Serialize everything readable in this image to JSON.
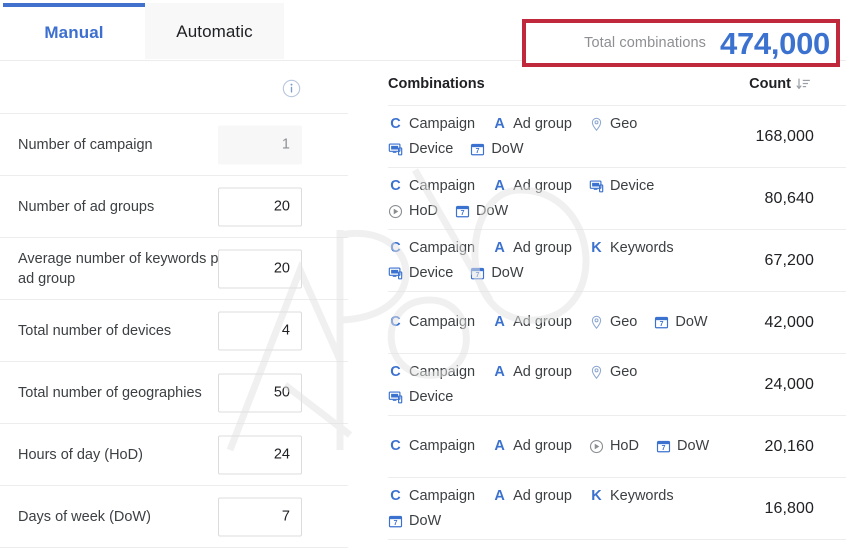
{
  "tabs": [
    {
      "label": "Manual",
      "active": true,
      "name": "tab-manual"
    },
    {
      "label": "Automatic",
      "active": false,
      "name": "tab-automatic"
    }
  ],
  "colors": {
    "accent_blue": "#3c72cf",
    "tab_active_border": "#4171cd",
    "callout_border": "#c0283b",
    "text_primary": "#202124",
    "text_secondary": "#8d8f92",
    "divider": "#ededed"
  },
  "summary": {
    "label": "Total combinations",
    "value": "474,000",
    "highlight_border_color": "#c0283b"
  },
  "form": {
    "info_icon": "info-circle-icon",
    "fields": [
      {
        "label": "Number of campaign",
        "value": "1",
        "disabled": true
      },
      {
        "label": "Number of ad groups",
        "value": "20",
        "disabled": false
      },
      {
        "label": "Average number of keywords per ad group",
        "value": "20",
        "disabled": false
      },
      {
        "label": "Total number of devices",
        "value": "4",
        "disabled": false
      },
      {
        "label": "Total number of geographies",
        "value": "50",
        "disabled": false
      },
      {
        "label": "Hours of day (HoD)",
        "value": "24",
        "disabled": false
      },
      {
        "label": "Days of week (DoW)",
        "value": "7",
        "disabled": false
      }
    ]
  },
  "table": {
    "columns": [
      {
        "header": "Combinations",
        "name": "column-combinations"
      },
      {
        "header": "Count",
        "name": "column-count",
        "sort_icon": "sort-descending-icon",
        "sorted": "descending"
      }
    ],
    "rows": [
      {
        "tags": [
          {
            "label": "Campaign",
            "icon": "letter-c-icon"
          },
          {
            "label": "Ad group",
            "icon": "letter-a-icon"
          },
          {
            "label": "Geo",
            "icon": "map-pin-icon"
          },
          {
            "label": "Device",
            "icon": "device-monitor-icon"
          },
          {
            "label": "DoW",
            "icon": "calendar-icon"
          }
        ],
        "count": "168,000"
      },
      {
        "tags": [
          {
            "label": "Campaign",
            "icon": "letter-c-icon"
          },
          {
            "label": "Ad group",
            "icon": "letter-a-icon"
          },
          {
            "label": "Device",
            "icon": "device-monitor-icon"
          },
          {
            "label": "HoD",
            "icon": "clock-icon"
          },
          {
            "label": "DoW",
            "icon": "calendar-icon"
          }
        ],
        "count": "80,640"
      },
      {
        "tags": [
          {
            "label": "Campaign",
            "icon": "letter-c-icon"
          },
          {
            "label": "Ad group",
            "icon": "letter-a-icon"
          },
          {
            "label": "Keywords",
            "icon": "letter-k-icon"
          },
          {
            "label": "Device",
            "icon": "device-monitor-icon"
          },
          {
            "label": "DoW",
            "icon": "calendar-icon"
          }
        ],
        "count": "67,200"
      },
      {
        "tags": [
          {
            "label": "Campaign",
            "icon": "letter-c-icon"
          },
          {
            "label": "Ad group",
            "icon": "letter-a-icon"
          },
          {
            "label": "Geo",
            "icon": "map-pin-icon"
          },
          {
            "label": "DoW",
            "icon": "calendar-icon"
          }
        ],
        "count": "42,000"
      },
      {
        "tags": [
          {
            "label": "Campaign",
            "icon": "letter-c-icon"
          },
          {
            "label": "Ad group",
            "icon": "letter-a-icon"
          },
          {
            "label": "Geo",
            "icon": "map-pin-icon"
          },
          {
            "label": "Device",
            "icon": "device-monitor-icon"
          }
        ],
        "count": "24,000"
      },
      {
        "tags": [
          {
            "label": "Campaign",
            "icon": "letter-c-icon"
          },
          {
            "label": "Ad group",
            "icon": "letter-a-icon"
          },
          {
            "label": "HoD",
            "icon": "clock-icon"
          },
          {
            "label": "DoW",
            "icon": "calendar-icon"
          }
        ],
        "count": "20,160"
      },
      {
        "tags": [
          {
            "label": "Campaign",
            "icon": "letter-c-icon"
          },
          {
            "label": "Ad group",
            "icon": "letter-a-icon"
          },
          {
            "label": "Keywords",
            "icon": "letter-k-icon"
          },
          {
            "label": "DoW",
            "icon": "calendar-icon"
          }
        ],
        "count": "16,800"
      }
    ]
  }
}
